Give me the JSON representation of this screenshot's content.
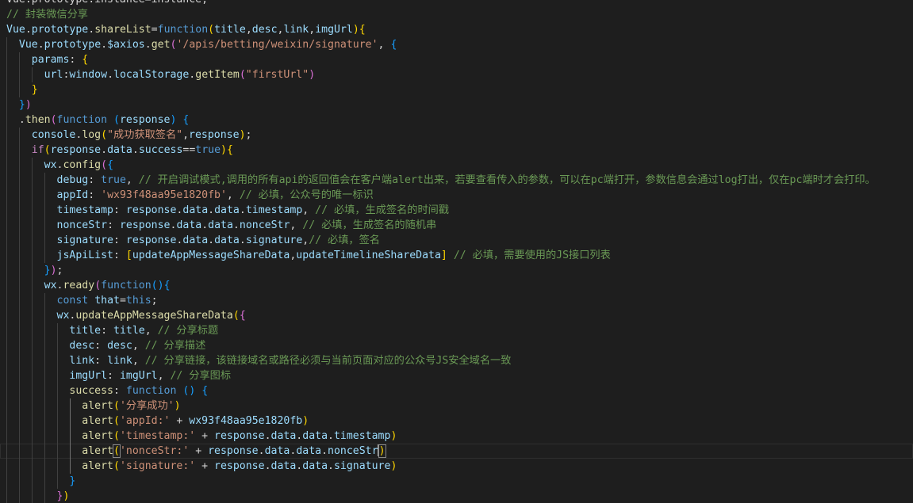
{
  "editor": {
    "theme": "dark",
    "background": "#1e1e1e",
    "cursor_line": 30,
    "colors": {
      "comment": "#6a9955",
      "keyword": "#569cd6",
      "string": "#ce9178",
      "variable": "#9cdcfe",
      "function": "#dcdcaa",
      "bracket_1": "#ffd700",
      "bracket_2": "#da70d6",
      "bracket_3": "#179fff"
    },
    "lines": [
      [
        [
          "Vue.prototype.instance=instance;",
          "plain"
        ]
      ],
      [
        [
          "// 封装微信分享",
          "comment"
        ]
      ],
      [
        [
          "Vue",
          "var"
        ],
        [
          ".",
          "plain"
        ],
        [
          "prototype",
          "var"
        ],
        [
          ".",
          "plain"
        ],
        [
          "shareList",
          "func"
        ],
        [
          "=",
          "plain"
        ],
        [
          "function",
          "keyword"
        ],
        [
          "(",
          "b1"
        ],
        [
          "title",
          "var"
        ],
        [
          ",",
          "plain"
        ],
        [
          "desc",
          "var"
        ],
        [
          ",",
          "plain"
        ],
        [
          "link",
          "var"
        ],
        [
          ",",
          "plain"
        ],
        [
          "imgUrl",
          "var"
        ],
        [
          ")",
          "b1"
        ],
        [
          "{",
          "b1"
        ]
      ],
      [
        [
          "  ",
          "plain"
        ],
        [
          "Vue",
          "var"
        ],
        [
          ".",
          "plain"
        ],
        [
          "prototype",
          "var"
        ],
        [
          ".",
          "plain"
        ],
        [
          "$axios",
          "var"
        ],
        [
          ".",
          "plain"
        ],
        [
          "get",
          "func"
        ],
        [
          "(",
          "b2"
        ],
        [
          "'/apis/betting/weixin/signature'",
          "string"
        ],
        [
          ", ",
          "plain"
        ],
        [
          "{",
          "b3"
        ]
      ],
      [
        [
          "    ",
          "plain"
        ],
        [
          "params",
          "var"
        ],
        [
          ": ",
          "plain"
        ],
        [
          "{",
          "b1"
        ]
      ],
      [
        [
          "      ",
          "plain"
        ],
        [
          "url",
          "var"
        ],
        [
          ":",
          "plain"
        ],
        [
          "window",
          "var"
        ],
        [
          ".",
          "plain"
        ],
        [
          "localStorage",
          "var"
        ],
        [
          ".",
          "plain"
        ],
        [
          "getItem",
          "func"
        ],
        [
          "(",
          "b2"
        ],
        [
          "\"firstUrl\"",
          "string"
        ],
        [
          ")",
          "b2"
        ]
      ],
      [
        [
          "    ",
          "plain"
        ],
        [
          "}",
          "b1"
        ]
      ],
      [
        [
          "  ",
          "plain"
        ],
        [
          "}",
          "b3"
        ],
        [
          ")",
          "b2"
        ]
      ],
      [
        [
          "  .",
          "plain"
        ],
        [
          "then",
          "func"
        ],
        [
          "(",
          "b2"
        ],
        [
          "function",
          "keyword"
        ],
        [
          " ",
          "plain"
        ],
        [
          "(",
          "b3"
        ],
        [
          "response",
          "var"
        ],
        [
          ")",
          "b3"
        ],
        [
          " ",
          "plain"
        ],
        [
          "{",
          "b3"
        ]
      ],
      [
        [
          "    ",
          "plain"
        ],
        [
          "console",
          "var"
        ],
        [
          ".",
          "plain"
        ],
        [
          "log",
          "func"
        ],
        [
          "(",
          "b1"
        ],
        [
          "\"成功获取签名\"",
          "string"
        ],
        [
          ",",
          "plain"
        ],
        [
          "response",
          "var"
        ],
        [
          ")",
          "b1"
        ],
        [
          ";",
          "plain"
        ]
      ],
      [
        [
          "    ",
          "plain"
        ],
        [
          "if",
          "control"
        ],
        [
          "(",
          "b1"
        ],
        [
          "response",
          "var"
        ],
        [
          ".",
          "plain"
        ],
        [
          "data",
          "var"
        ],
        [
          ".",
          "plain"
        ],
        [
          "success",
          "var"
        ],
        [
          "==",
          "plain"
        ],
        [
          "true",
          "keyword"
        ],
        [
          ")",
          "b1"
        ],
        [
          "{",
          "b1"
        ]
      ],
      [
        [
          "      ",
          "plain"
        ],
        [
          "wx",
          "var"
        ],
        [
          ".",
          "plain"
        ],
        [
          "config",
          "func"
        ],
        [
          "(",
          "b2"
        ],
        [
          "{",
          "b3"
        ]
      ],
      [
        [
          "        ",
          "plain"
        ],
        [
          "debug",
          "var"
        ],
        [
          ": ",
          "plain"
        ],
        [
          "true",
          "keyword"
        ],
        [
          ", ",
          "plain"
        ],
        [
          "// 开启调试模式,调用的所有api的返回值会在客户端alert出来，若要查看传入的参数，可以在pc端打开，参数信息会通过log打出，仅在pc端时才会打印。",
          "comment"
        ]
      ],
      [
        [
          "        ",
          "plain"
        ],
        [
          "appId",
          "var"
        ],
        [
          ": ",
          "plain"
        ],
        [
          "'wx93f48aa95e1820fb'",
          "string"
        ],
        [
          ", ",
          "plain"
        ],
        [
          "// 必填，公众号的唯一标识",
          "comment"
        ]
      ],
      [
        [
          "        ",
          "plain"
        ],
        [
          "timestamp",
          "var"
        ],
        [
          ": ",
          "plain"
        ],
        [
          "response",
          "var"
        ],
        [
          ".",
          "plain"
        ],
        [
          "data",
          "var"
        ],
        [
          ".",
          "plain"
        ],
        [
          "data",
          "var"
        ],
        [
          ".",
          "plain"
        ],
        [
          "timestamp",
          "var"
        ],
        [
          ", ",
          "plain"
        ],
        [
          "// 必填，生成签名的时间戳",
          "comment"
        ]
      ],
      [
        [
          "        ",
          "plain"
        ],
        [
          "nonceStr",
          "var"
        ],
        [
          ": ",
          "plain"
        ],
        [
          "response",
          "var"
        ],
        [
          ".",
          "plain"
        ],
        [
          "data",
          "var"
        ],
        [
          ".",
          "plain"
        ],
        [
          "data",
          "var"
        ],
        [
          ".",
          "plain"
        ],
        [
          "nonceStr",
          "var"
        ],
        [
          ", ",
          "plain"
        ],
        [
          "// 必填，生成签名的随机串",
          "comment"
        ]
      ],
      [
        [
          "        ",
          "plain"
        ],
        [
          "signature",
          "var"
        ],
        [
          ": ",
          "plain"
        ],
        [
          "response",
          "var"
        ],
        [
          ".",
          "plain"
        ],
        [
          "data",
          "var"
        ],
        [
          ".",
          "plain"
        ],
        [
          "data",
          "var"
        ],
        [
          ".",
          "plain"
        ],
        [
          "signature",
          "var"
        ],
        [
          ",",
          "plain"
        ],
        [
          "// 必填，签名",
          "comment"
        ]
      ],
      [
        [
          "        ",
          "plain"
        ],
        [
          "jsApiList",
          "var"
        ],
        [
          ": ",
          "plain"
        ],
        [
          "[",
          "b1"
        ],
        [
          "updateAppMessageShareData",
          "var"
        ],
        [
          ",",
          "plain"
        ],
        [
          "updateTimelineShareData",
          "var"
        ],
        [
          "]",
          "b1"
        ],
        [
          " ",
          "plain"
        ],
        [
          "// 必填，需要使用的JS接口列表",
          "comment"
        ]
      ],
      [
        [
          "      ",
          "plain"
        ],
        [
          "}",
          "b3"
        ],
        [
          ")",
          "b2"
        ],
        [
          ";",
          "plain"
        ]
      ],
      [
        [
          "      ",
          "plain"
        ],
        [
          "wx",
          "var"
        ],
        [
          ".",
          "plain"
        ],
        [
          "ready",
          "func"
        ],
        [
          "(",
          "b2"
        ],
        [
          "function",
          "keyword"
        ],
        [
          "(",
          "b3"
        ],
        [
          ")",
          "b3"
        ],
        [
          "{",
          "b3"
        ]
      ],
      [
        [
          "        ",
          "plain"
        ],
        [
          "const",
          "keyword"
        ],
        [
          " ",
          "plain"
        ],
        [
          "that",
          "var"
        ],
        [
          "=",
          "plain"
        ],
        [
          "this",
          "keyword"
        ],
        [
          ";",
          "plain"
        ]
      ],
      [
        [
          "        ",
          "plain"
        ],
        [
          "wx",
          "var"
        ],
        [
          ".",
          "plain"
        ],
        [
          "updateAppMessageShareData",
          "func"
        ],
        [
          "(",
          "b1"
        ],
        [
          "{",
          "b2"
        ]
      ],
      [
        [
          "          ",
          "plain"
        ],
        [
          "title",
          "var"
        ],
        [
          ": ",
          "plain"
        ],
        [
          "title",
          "var"
        ],
        [
          ", ",
          "plain"
        ],
        [
          "// 分享标题",
          "comment"
        ]
      ],
      [
        [
          "          ",
          "plain"
        ],
        [
          "desc",
          "var"
        ],
        [
          ": ",
          "plain"
        ],
        [
          "desc",
          "var"
        ],
        [
          ", ",
          "plain"
        ],
        [
          "// 分享描述",
          "comment"
        ]
      ],
      [
        [
          "          ",
          "plain"
        ],
        [
          "link",
          "var"
        ],
        [
          ": ",
          "plain"
        ],
        [
          "link",
          "var"
        ],
        [
          ", ",
          "plain"
        ],
        [
          "// 分享链接，该链接域名或路径必须与当前页面对应的公众号JS安全域名一致",
          "comment"
        ]
      ],
      [
        [
          "          ",
          "plain"
        ],
        [
          "imgUrl",
          "var"
        ],
        [
          ": ",
          "plain"
        ],
        [
          "imgUrl",
          "var"
        ],
        [
          ", ",
          "plain"
        ],
        [
          "// 分享图标",
          "comment"
        ]
      ],
      [
        [
          "          ",
          "plain"
        ],
        [
          "success",
          "func"
        ],
        [
          ": ",
          "plain"
        ],
        [
          "function",
          "keyword"
        ],
        [
          " ",
          "plain"
        ],
        [
          "(",
          "b3"
        ],
        [
          ")",
          "b3"
        ],
        [
          " ",
          "plain"
        ],
        [
          "{",
          "b3"
        ]
      ],
      [
        [
          "            ",
          "plain"
        ],
        [
          "alert",
          "func"
        ],
        [
          "(",
          "b1"
        ],
        [
          "'分享成功'",
          "string"
        ],
        [
          ")",
          "b1"
        ]
      ],
      [
        [
          "            ",
          "plain"
        ],
        [
          "alert",
          "func"
        ],
        [
          "(",
          "b1"
        ],
        [
          "'appId:'",
          "string"
        ],
        [
          " + ",
          "plain"
        ],
        [
          "wx93f48aa95e1820fb",
          "var"
        ],
        [
          ")",
          "b1"
        ]
      ],
      [
        [
          "            ",
          "plain"
        ],
        [
          "alert",
          "func"
        ],
        [
          "(",
          "b1"
        ],
        [
          "'timestamp:'",
          "string"
        ],
        [
          " + ",
          "plain"
        ],
        [
          "response",
          "var"
        ],
        [
          ".",
          "plain"
        ],
        [
          "data",
          "var"
        ],
        [
          ".",
          "plain"
        ],
        [
          "data",
          "var"
        ],
        [
          ".",
          "plain"
        ],
        [
          "timestamp",
          "var"
        ],
        [
          ")",
          "b1"
        ]
      ],
      [
        [
          "            ",
          "plain"
        ],
        [
          "alert",
          "func"
        ],
        [
          "(",
          "b1m"
        ],
        [
          "'nonceStr:'",
          "string"
        ],
        [
          " + ",
          "plain"
        ],
        [
          "response",
          "var"
        ],
        [
          ".",
          "plain"
        ],
        [
          "data",
          "var"
        ],
        [
          ".",
          "plain"
        ],
        [
          "data",
          "var"
        ],
        [
          ".",
          "plain"
        ],
        [
          "nonceStr",
          "var"
        ],
        [
          ")",
          "b1m"
        ]
      ],
      [
        [
          "            ",
          "plain"
        ],
        [
          "alert",
          "func"
        ],
        [
          "(",
          "b1"
        ],
        [
          "'signature:'",
          "string"
        ],
        [
          " + ",
          "plain"
        ],
        [
          "response",
          "var"
        ],
        [
          ".",
          "plain"
        ],
        [
          "data",
          "var"
        ],
        [
          ".",
          "plain"
        ],
        [
          "data",
          "var"
        ],
        [
          ".",
          "plain"
        ],
        [
          "signature",
          "var"
        ],
        [
          ")",
          "b1"
        ]
      ],
      [
        [
          "          ",
          "plain"
        ],
        [
          "}",
          "b3"
        ]
      ],
      [
        [
          "        ",
          "plain"
        ],
        [
          "}",
          "b2"
        ],
        [
          ")",
          "b1"
        ]
      ]
    ]
  }
}
